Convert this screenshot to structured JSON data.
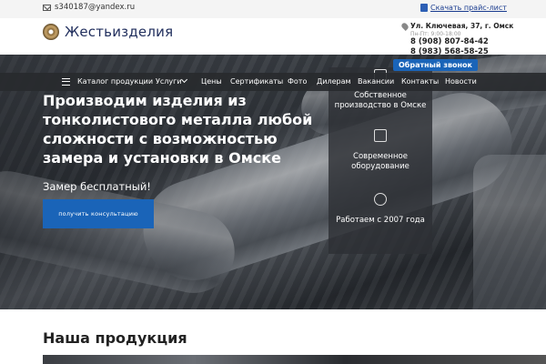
{
  "topbar": {
    "email": "s340187@yandex.ru",
    "price_link": "Скачать прайс-лист"
  },
  "header": {
    "logo_text": "Жестьизделия",
    "address": "Ул. Ключевая, 37, г. Омск",
    "hours": "Пн-Пт: 9:00-18:00",
    "phones": [
      "8 (908) 807-84-42",
      "8 (983) 568-58-25"
    ],
    "callback_label": "Обратный звонок"
  },
  "nav": {
    "items": [
      "Каталог продукции",
      "Услуги",
      "Цены",
      "Сертификаты",
      "Фото",
      "Дилерам",
      "Вакансии",
      "Контакты",
      "Новости"
    ]
  },
  "hero": {
    "title": "Производим изделия из тонколистового металла любой сложности с возможностью замера и установки в Омске",
    "subtitle": "Замер бесплатный!",
    "cta_label": "получить консультацию"
  },
  "features": [
    {
      "label": "Собственное производство в Омске",
      "icon": "factory-icon"
    },
    {
      "label": "Современное оборудование",
      "icon": "machine-icon"
    },
    {
      "label": "Работаем с 2007 года",
      "icon": "worker-icon"
    }
  ],
  "products": {
    "title": "Наша продукция"
  },
  "colors": {
    "accent": "#1a64b8",
    "logo_text": "#1f2d5c",
    "nav_bg": "#2a2c30"
  }
}
